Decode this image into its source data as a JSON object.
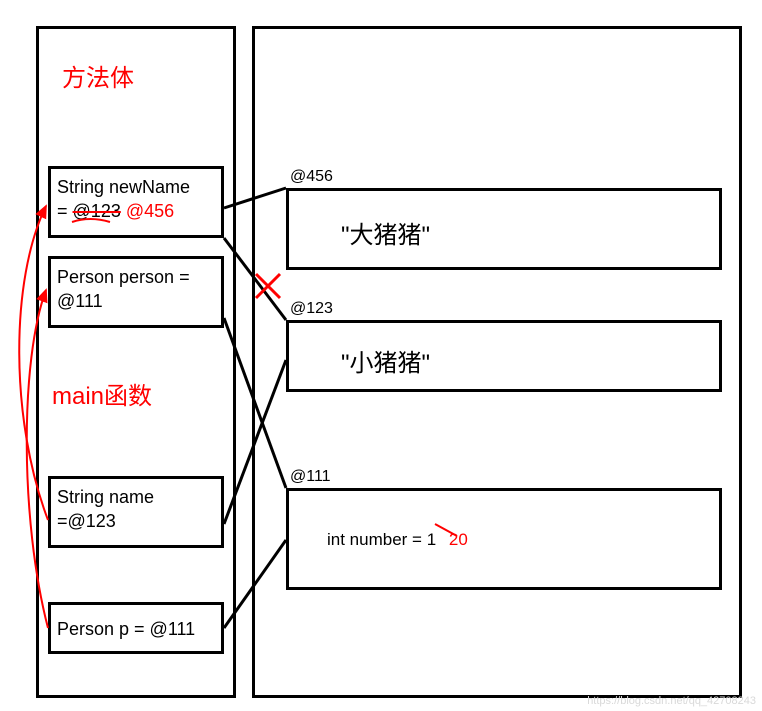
{
  "stack_title": "方法体",
  "main_title": "main函数",
  "stack_boxes": {
    "newName": {
      "line1": "String newName",
      "old_addr": "@123",
      "new_addr": "@456",
      "eq": "="
    },
    "person": "Person person =\n@111",
    "name": "String name\n=@123",
    "p": "Person p = @111"
  },
  "heap_objects": {
    "obj456": {
      "addr": "@456",
      "value": "\"大猪猪\""
    },
    "obj123": {
      "addr": "@123",
      "value": "\"小猪猪\""
    },
    "obj111": {
      "addr": "@111",
      "field_label": "int number =",
      "old_val": "1",
      "new_val": "20"
    }
  },
  "watermark": "https://blog.csdn.net/qq_42708243"
}
